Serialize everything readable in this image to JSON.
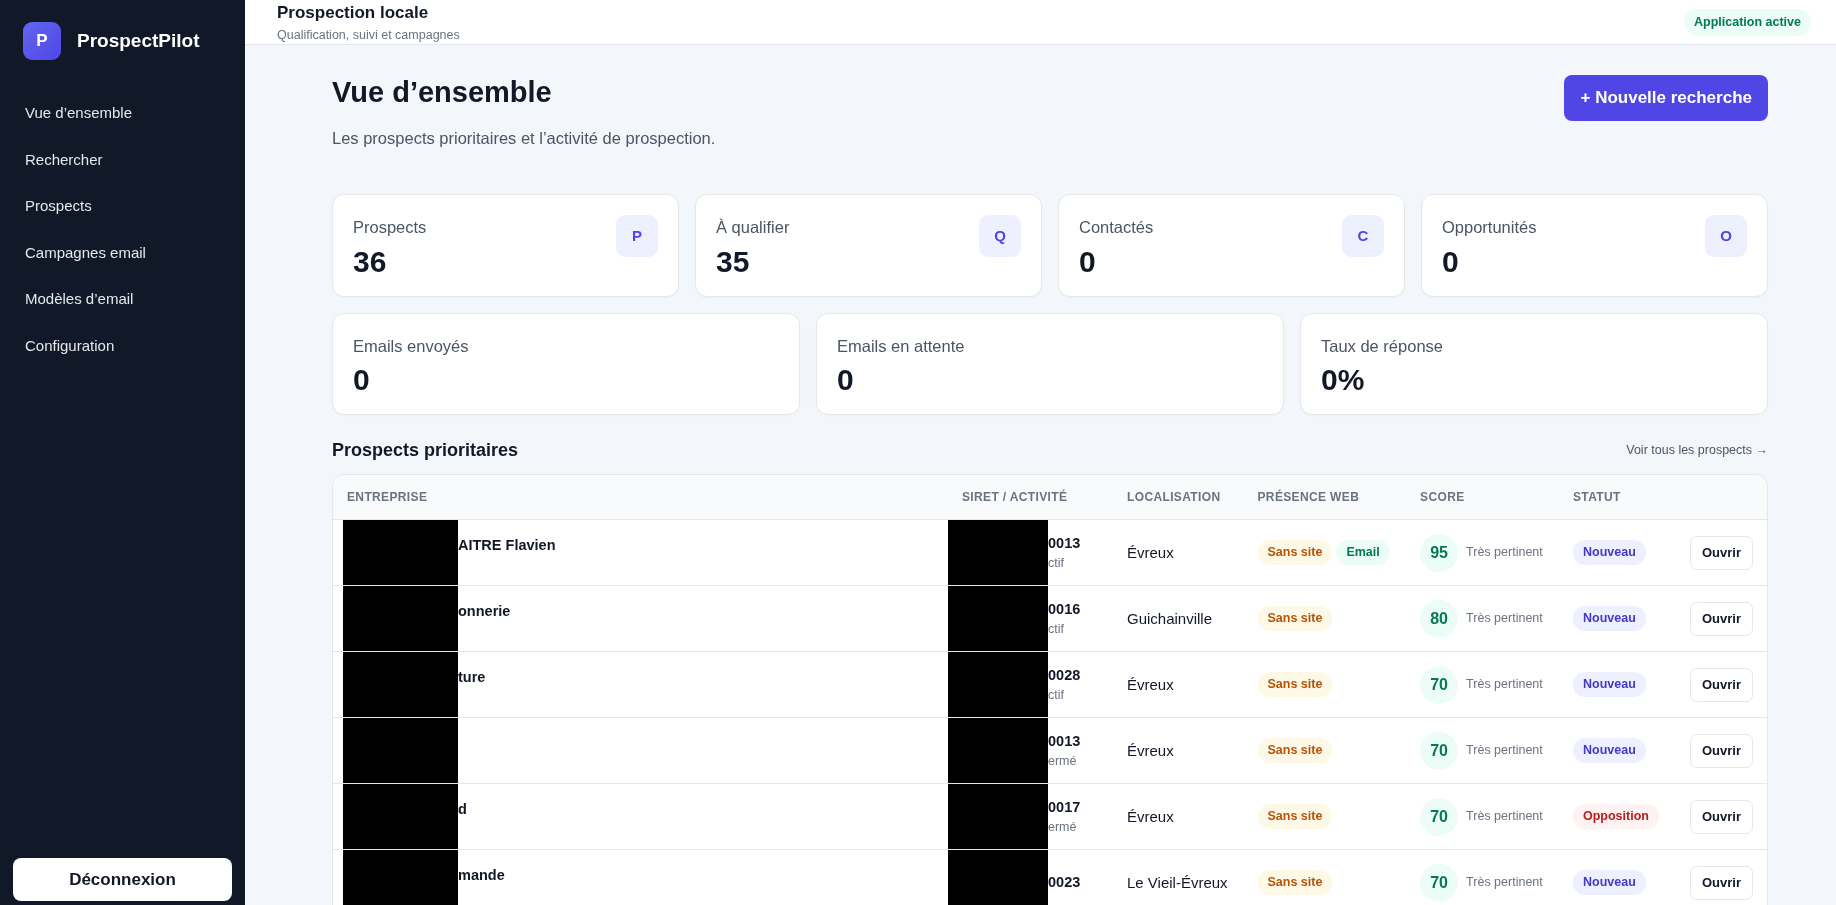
{
  "sidebar": {
    "logo_letter": "P",
    "brand": "ProspectPilot",
    "items": [
      {
        "label": "Vue d’ensemble"
      },
      {
        "label": "Rechercher"
      },
      {
        "label": "Prospects"
      },
      {
        "label": "Campagnes email"
      },
      {
        "label": "Modèles d’email"
      },
      {
        "label": "Configuration"
      }
    ],
    "logout": "Déconnexion"
  },
  "header": {
    "title": "Prospection locale",
    "subtitle": "Qualification, suivi et campagnes",
    "status_badge": "Application active"
  },
  "page": {
    "title": "Vue d’ensemble",
    "subtitle": "Les prospects prioritaires et l’activité de prospection.",
    "primary_button": "+ Nouvelle recherche"
  },
  "stats_top": [
    {
      "label": "Prospects",
      "value": "36",
      "icon_letter": "P"
    },
    {
      "label": "À qualifier",
      "value": "35",
      "icon_letter": "Q"
    },
    {
      "label": "Contactés",
      "value": "0",
      "icon_letter": "C"
    },
    {
      "label": "Opportunités",
      "value": "0",
      "icon_letter": "O"
    }
  ],
  "stats_bottom": [
    {
      "label": "Emails envoyés",
      "value": "0"
    },
    {
      "label": "Emails en attente",
      "value": "0"
    },
    {
      "label": "Taux de réponse",
      "value": "0%"
    }
  ],
  "section": {
    "title": "Prospects prioritaires",
    "link": "Voir tous les prospects →"
  },
  "table": {
    "columns": [
      "ENTREPRISE",
      "SIRET / ACTIVITÉ",
      "LOCALISATION",
      "PRÉSENCE WEB",
      "SCORE",
      "STATUT"
    ],
    "rows": [
      {
        "company": "AITRE Flavien",
        "siret": "0013",
        "activity": "ctif",
        "location": "Évreux",
        "web": [
          {
            "label": "Sans site",
            "kind": "warning"
          },
          {
            "label": "Email",
            "kind": "success"
          }
        ],
        "score": "95",
        "score_label": "Très pertinent",
        "status": {
          "label": "Nouveau",
          "kind": "new"
        },
        "action": "Ouvrir"
      },
      {
        "company": "onnerie",
        "siret": "0016",
        "activity": "ctif",
        "location": "Guichainville",
        "web": [
          {
            "label": "Sans site",
            "kind": "warning"
          }
        ],
        "score": "80",
        "score_label": "Très pertinent",
        "status": {
          "label": "Nouveau",
          "kind": "new"
        },
        "action": "Ouvrir"
      },
      {
        "company": "ture",
        "siret": "0028",
        "activity": "ctif",
        "location": "Évreux",
        "web": [
          {
            "label": "Sans site",
            "kind": "warning"
          }
        ],
        "score": "70",
        "score_label": "Très pertinent",
        "status": {
          "label": "Nouveau",
          "kind": "new"
        },
        "action": "Ouvrir"
      },
      {
        "company": "",
        "siret": "0013",
        "activity": "ermé",
        "location": "Évreux",
        "web": [
          {
            "label": "Sans site",
            "kind": "warning"
          }
        ],
        "score": "70",
        "score_label": "Très pertinent",
        "status": {
          "label": "Nouveau",
          "kind": "new"
        },
        "action": "Ouvrir"
      },
      {
        "company": "d",
        "siret": "0017",
        "activity": "ermé",
        "location": "Évreux",
        "web": [
          {
            "label": "Sans site",
            "kind": "warning"
          }
        ],
        "score": "70",
        "score_label": "Très pertinent",
        "status": {
          "label": "Opposition",
          "kind": "opposition"
        },
        "action": "Ouvrir"
      },
      {
        "company": "mande",
        "siret": "0023",
        "location": "Le Vieil-Évreux",
        "web": [
          {
            "label": "Sans site",
            "kind": "warning"
          }
        ],
        "score": "70",
        "score_label": "Très pertinent",
        "status": {
          "label": "Nouveau",
          "kind": "new"
        },
        "action": "Ouvrir"
      }
    ]
  }
}
